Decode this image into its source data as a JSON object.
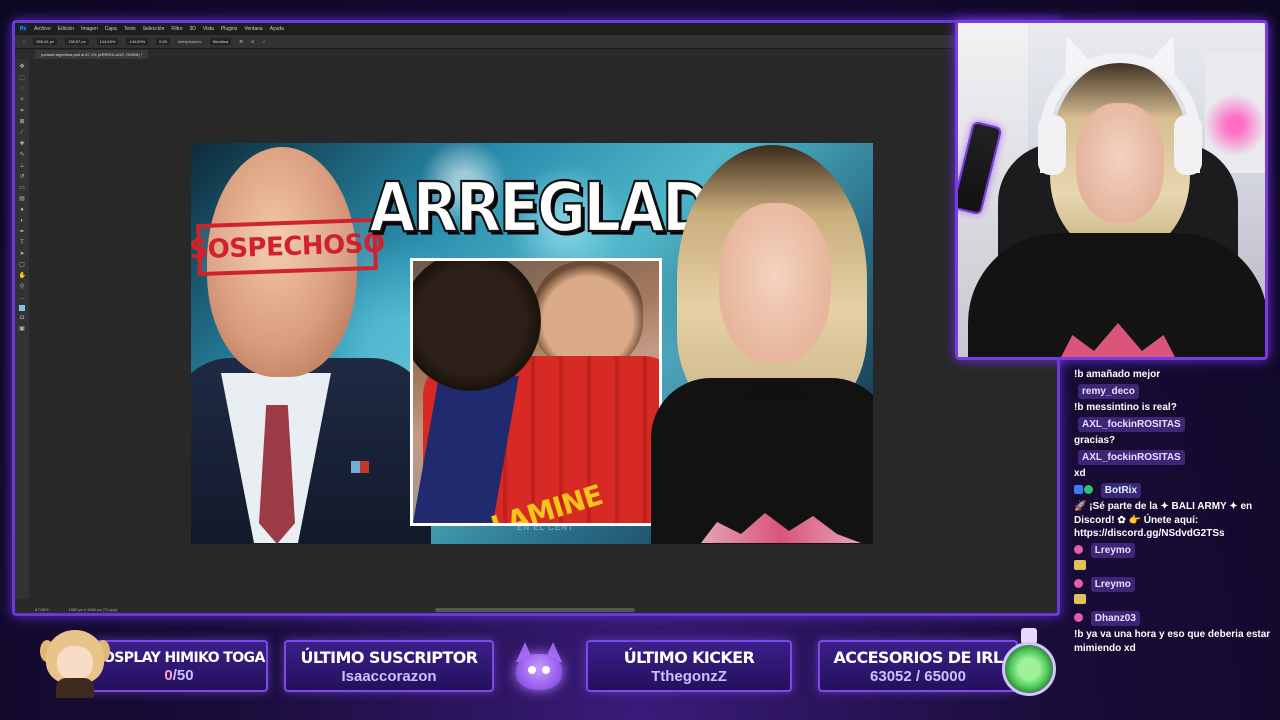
{
  "photoshop": {
    "logo": "Ps",
    "menu": [
      "Archivo",
      "Edición",
      "Imagen",
      "Capa",
      "Texto",
      "Selección",
      "Filtro",
      "3D",
      "Vista",
      "Plugins",
      "Ventana",
      "Ayuda"
    ],
    "options": {
      "x": "555,64 px",
      "y": "138,57 px",
      "w": "144,63%",
      "h": "144,63%",
      "angle": "0,00",
      "interp_label": "Interpolación:",
      "interp_value": "Bicúbica"
    },
    "tab_title": "portada argentina.psd al 87,1% (ARREGLADO, RGB/8) *",
    "status": {
      "zoom": "87,06%",
      "size": "1950 px x 1080 px (72 ppp)"
    }
  },
  "thumbnail": {
    "stamp": "SOSPECHOSO",
    "headline": "ARREGLADO?",
    "jersey": "LAMINE YAM",
    "caption": "EN EL CENT"
  },
  "chat": {
    "messages": [
      {
        "user": "",
        "text": "!b amañado mejor"
      },
      {
        "user": "remy_deco",
        "text": "!b messintino is real?"
      },
      {
        "user": "AXL_fockinROSITAS",
        "text": "gracias?"
      },
      {
        "user": "AXL_fockinROSITAS",
        "text": "xd"
      },
      {
        "user": "BotRix",
        "text": "🚀 ¡Sé parte de la ✦ BALI ARMY ✦ en Discord! ✿ 👉 Únete aquí: https://discord.gg/NSdvdG2TSs"
      },
      {
        "user": "Lreymo",
        "text": ""
      },
      {
        "user": "Lreymo",
        "text": ""
      },
      {
        "user": "Dhanz03",
        "text": "!b ya va una hora y eso que deberia estar mimiendo xd"
      }
    ]
  },
  "bottom": {
    "goal_title": "COSPLAY HIMIKO TOGA",
    "goal_current": "0",
    "goal_total": "/50",
    "sub_title": "ÚLTIMO SUSCRIPTOR",
    "sub_name": "Isaaccorazon",
    "kicker_title": "ÚLTIMO KICKER",
    "kicker_name": "TthegonzZ",
    "irl_title": "ACCESORIOS DE IRL",
    "irl_value": "63052 / 65000"
  }
}
